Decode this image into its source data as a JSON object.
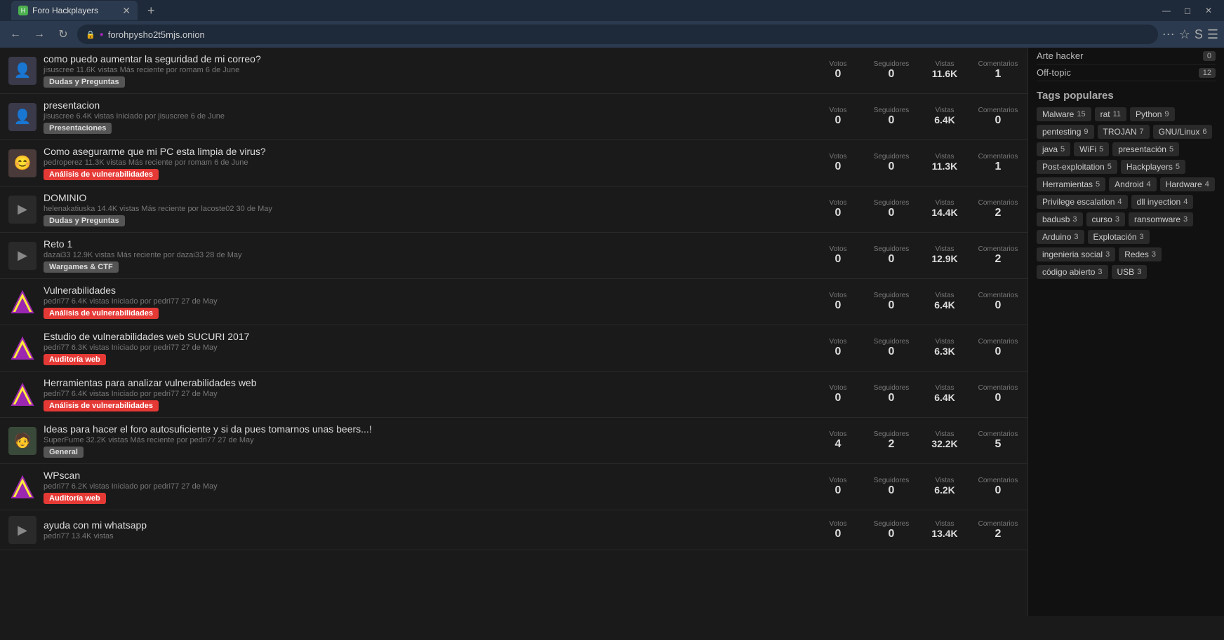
{
  "browser": {
    "tab_title": "Foro Hackplayers",
    "url": "forohpysho2t5mjs.onion",
    "new_tab_symbol": "+",
    "win_minimize": "—",
    "win_restore": "◻",
    "win_close": "✕"
  },
  "sidebar_categories": [
    {
      "label": "Arte hacker",
      "count": "0"
    },
    {
      "label": "Off-topic",
      "count": "12"
    }
  ],
  "tags_popular_title": "Tags populares",
  "popular_tags": [
    {
      "label": "Malware",
      "count": "15"
    },
    {
      "label": "rat",
      "count": "11"
    },
    {
      "label": "Python",
      "count": "9"
    },
    {
      "label": "pentesting",
      "count": "9"
    },
    {
      "label": "TROJAN",
      "count": "7"
    },
    {
      "label": "GNU/Linux",
      "count": "6"
    },
    {
      "label": "java",
      "count": "5"
    },
    {
      "label": "WiFi",
      "count": "5"
    },
    {
      "label": "presentación",
      "count": "5"
    },
    {
      "label": "Post-exploitation",
      "count": "5"
    },
    {
      "label": "Hackplayers",
      "count": "5"
    },
    {
      "label": "Herramientas",
      "count": "5"
    },
    {
      "label": "Android",
      "count": "4"
    },
    {
      "label": "Hardware",
      "count": "4"
    },
    {
      "label": "Privilege escalation",
      "count": "4"
    },
    {
      "label": "dll inyection",
      "count": "4"
    },
    {
      "label": "badusb",
      "count": "3"
    },
    {
      "label": "curso",
      "count": "3"
    },
    {
      "label": "ransomware",
      "count": "3"
    },
    {
      "label": "Arduino",
      "count": "3"
    },
    {
      "label": "Explotación",
      "count": "3"
    },
    {
      "label": "ingenieria social",
      "count": "3"
    },
    {
      "label": "Redes",
      "count": "3"
    },
    {
      "label": "código abierto",
      "count": "3"
    },
    {
      "label": "USB",
      "count": "3"
    }
  ],
  "threads": [
    {
      "title": "como puedo aumentar la seguridad de mi correo?",
      "author": "jisuscree",
      "views": "11.6K vistas",
      "recent_by": "Más reciente por romam",
      "date": "6 de June",
      "tag": "Dudas y Preguntas",
      "tag_class": "tag-dudas",
      "avatar_type": "user",
      "votes": "0",
      "followers": "0",
      "vistas": "11.6K",
      "comments": "1",
      "stat_label_v": "Votos",
      "stat_label_s": "Seguidores",
      "stat_label_vi": "Vistas",
      "stat_label_c": "Comentarios"
    },
    {
      "title": "presentacion",
      "author": "jisuscree",
      "views": "6.4K vistas",
      "recent_by": "Iniciado por jisuscree",
      "date": "6 de June",
      "tag": "Presentaciones",
      "tag_class": "tag-presentaciones",
      "avatar_type": "user",
      "votes": "0",
      "followers": "0",
      "vistas": "6.4K",
      "comments": "0"
    },
    {
      "title": "Como asegurarme que mi PC esta limpia de virus?",
      "author": "pedroperez",
      "views": "11.3K vistas",
      "recent_by": "Más reciente por romam",
      "date": "6 de June",
      "tag": "Análisis de vulnerabilidades",
      "tag_class": "tag-analisis",
      "avatar_type": "user2",
      "votes": "0",
      "followers": "0",
      "vistas": "11.3K",
      "comments": "1"
    },
    {
      "title": "DOMINIO",
      "author": "helenakatiuska",
      "views": "14.4K vistas",
      "recent_by": "Más reciente por lacoste02",
      "date": "30 de May",
      "tag": "Dudas y Preguntas",
      "tag_class": "tag-dudas",
      "avatar_type": "video",
      "votes": "0",
      "followers": "0",
      "vistas": "14.4K",
      "comments": "2"
    },
    {
      "title": "Reto 1",
      "author": "dazai33",
      "views": "12.9K vistas",
      "recent_by": "Más reciente por dazai33",
      "date": "28 de May",
      "tag": "Wargames & CTF",
      "tag_class": "tag-wargames",
      "avatar_type": "video",
      "votes": "0",
      "followers": "0",
      "vistas": "12.9K",
      "comments": "2"
    },
    {
      "title": "Vulnerabilidades",
      "author": "pedri77",
      "views": "6.4K vistas",
      "recent_by": "Iniciado por pedri77",
      "date": "27 de May",
      "tag": "Análisis de vulnerabilidades",
      "tag_class": "tag-analisis",
      "avatar_type": "hackplayers",
      "votes": "0",
      "followers": "0",
      "vistas": "6.4K",
      "comments": "0"
    },
    {
      "title": "Estudio de vulnerabilidades web SUCURI 2017",
      "author": "pedri77",
      "views": "6.3K vistas",
      "recent_by": "Iniciado por pedri77",
      "date": "27 de May",
      "tag": "Auditoría web",
      "tag_class": "tag-auditoria",
      "avatar_type": "hackplayers",
      "votes": "0",
      "followers": "0",
      "vistas": "6.3K",
      "comments": "0"
    },
    {
      "title": "Herramientas para analizar vulnerabilidades web",
      "author": "pedri77",
      "views": "6.4K vistas",
      "recent_by": "Iniciado por pedri77",
      "date": "27 de May",
      "tag": "Análisis de vulnerabilidades",
      "tag_class": "tag-analisis",
      "avatar_type": "hackplayers",
      "votes": "0",
      "followers": "0",
      "vistas": "6.4K",
      "comments": "0"
    },
    {
      "title": "Ideas para hacer el foro autosuficiente y si da pues tomarnos unas beers...!",
      "author": "SuperFume",
      "views": "32.2K vistas",
      "recent_by": "Más reciente por pedri77",
      "date": "27 de May",
      "tag": "General",
      "tag_class": "tag-general",
      "avatar_type": "user3",
      "votes": "4",
      "followers": "2",
      "vistas": "32.2K",
      "comments": "5"
    },
    {
      "title": "WPscan",
      "author": "pedri77",
      "views": "6.2K vistas",
      "recent_by": "Iniciado por pedri77",
      "date": "27 de May",
      "tag": "Auditoría web",
      "tag_class": "tag-auditoria",
      "avatar_type": "hackplayers",
      "votes": "0",
      "followers": "0",
      "vistas": "6.2K",
      "comments": "0"
    },
    {
      "title": "ayuda con mi whatsapp",
      "author": "pedri77",
      "views": "13.4K vistas",
      "recent_by": "",
      "date": "",
      "tag": "",
      "tag_class": "",
      "avatar_type": "video",
      "votes": "0",
      "followers": "0",
      "vistas": "13.4K",
      "comments": "2"
    }
  ],
  "stat_headers": {
    "votos": "Votos",
    "seguidores": "Seguidores",
    "vistas": "Vistas",
    "comentarios": "Comentarios"
  }
}
